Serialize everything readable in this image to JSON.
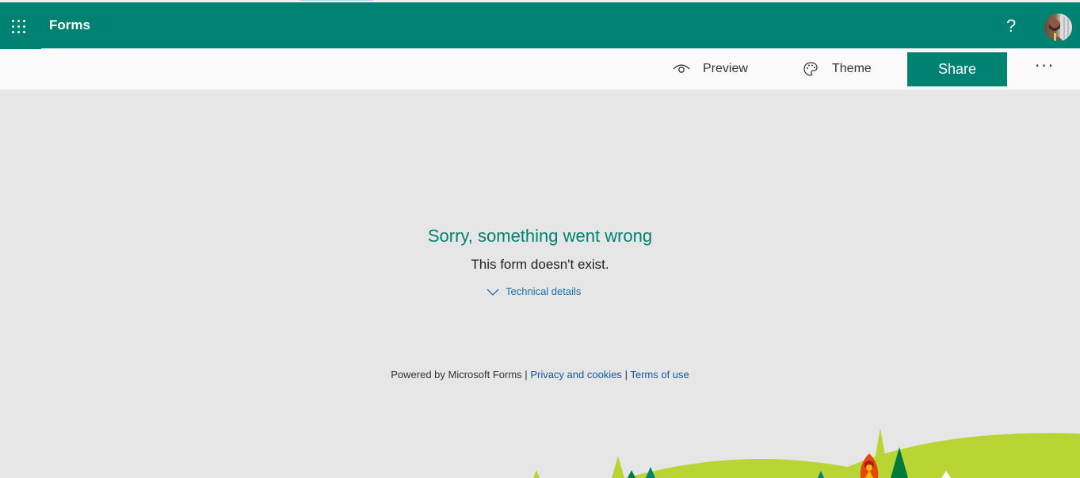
{
  "header": {
    "app_title": "Forms",
    "help_label": "?",
    "brand_color": "#008272"
  },
  "commandbar": {
    "preview_label": "Preview",
    "theme_label": "Theme",
    "share_label": "Share",
    "more_label": "···"
  },
  "error": {
    "title": "Sorry, something went wrong",
    "message": "This form doesn't exist.",
    "details_label": "Technical details"
  },
  "footer": {
    "powered_by": "Powered by Microsoft Forms",
    "separator": "|",
    "privacy_label": "Privacy and cookies",
    "terms_label": "Terms of use"
  },
  "colors": {
    "accent": "#008272",
    "link": "#1a6fb3",
    "background": "#e6e6e6",
    "hill": "#b8d534"
  }
}
